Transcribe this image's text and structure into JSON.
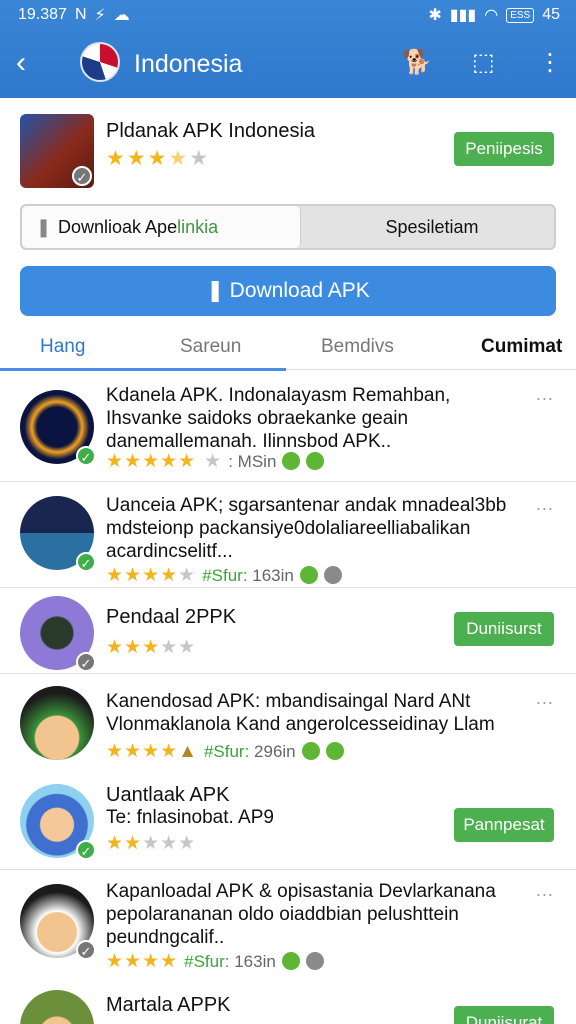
{
  "status": {
    "time": "19.387",
    "icons_left": [
      "N",
      "⚡",
      "☁"
    ],
    "battery": "ESS",
    "right_num": "45"
  },
  "toolbar": {
    "title": "Indonesia",
    "back_icon": "chevron-left-icon",
    "icons": [
      "dog-icon",
      "share-icon",
      "more-icon"
    ]
  },
  "hero": {
    "name": "Pldanak APK Indonesia",
    "rating": 3.5,
    "button": "Peniipesis",
    "segment_left": "Downlioak Ape",
    "segment_left_accent": "linkia",
    "segment_right": "Spesiletiam",
    "download": "Download APK"
  },
  "tabs": [
    "Hang",
    "Sareun",
    "Bemdivs",
    "Cumimat"
  ],
  "rows": [
    {
      "title": "Kdanela APK. Indonalayasm Remahban, Ihsvanke saidoks obraekanke geain danemallemanah. Ilinnsbod APK..",
      "stars": "★★★★★",
      "stars_grey": "★",
      "meta": ": MSin"
    },
    {
      "title": "Uanceia APK; sgarsantenar andak mnadeal3bb mdsteionp packansiye0dolaliareelliabalikan acardincselitf...",
      "stars": "★★★★",
      "stars_grey": "★",
      "meta_accent": "#Sfur:",
      "meta": " 163in"
    },
    {
      "title": "Pendaal 2PPK",
      "stars": "★★★",
      "stars_grey": "★★",
      "button": "Duniisurst"
    },
    {
      "title": "Kanendosad APK: mbandisaingal Nard ANt Vlonmaklanola Kand angerolcesseidinay Llam",
      "stars": "★★★★",
      "stars_grey": "▲",
      "meta_accent": "#Sfur:",
      "meta": " 296in"
    },
    {
      "title": "Uantlaak APK",
      "subtitle": "Te: fnlasinobat. AP9",
      "stars": "★★",
      "stars_grey": "★★★",
      "button": "Pannpesat"
    },
    {
      "title": "Kapanloadal APK & opisastania Devlarkanana pepolarananan oldo oiaddbian pelushttein peundngcalif..",
      "stars": "★★★★",
      "stars_grey": "",
      "meta_accent": "#Sfur:",
      "meta": " 163in"
    },
    {
      "title": "Martala APPK",
      "button": "Duniisurat"
    }
  ]
}
